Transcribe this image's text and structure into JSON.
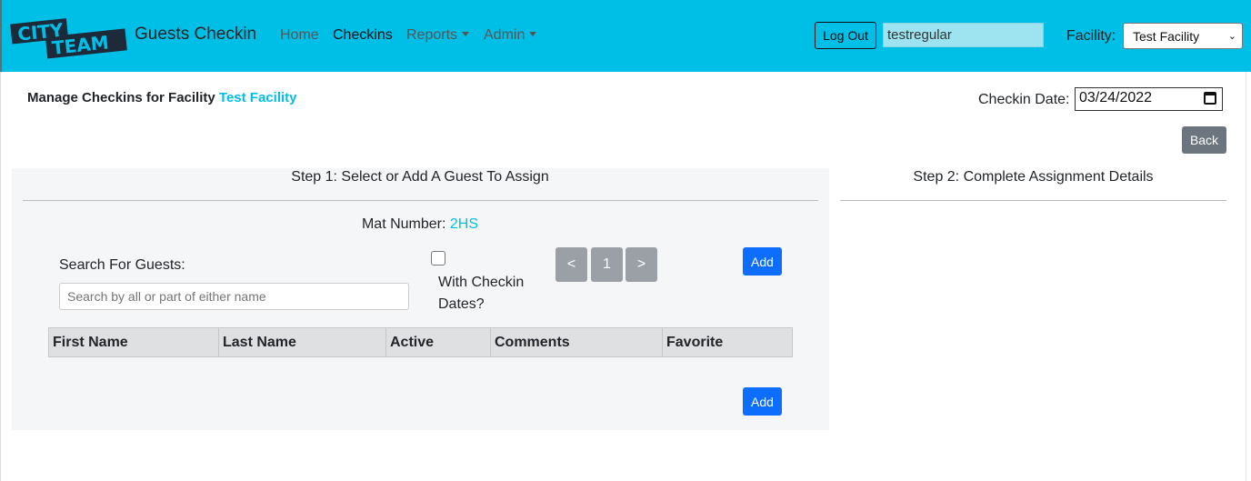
{
  "brand": {
    "logo_text_1": "CITY",
    "logo_text_2": "TEAM",
    "title": "Guests Checkin"
  },
  "nav": {
    "home": "Home",
    "checkins": "Checkins",
    "reports": "Reports",
    "admin": "Admin"
  },
  "header": {
    "logout_label": "Log Out",
    "username": "testregular",
    "facility_label": "Facility:",
    "facility_selected": "Test Facility"
  },
  "page": {
    "heading_prefix": "Manage Checkins for Facility",
    "facility_name": "Test Facility",
    "checkin_date_label": "Checkin Date:",
    "checkin_date": "03/24/2022",
    "back_label": "Back"
  },
  "step1": {
    "title": "Step 1: Select or Add A Guest To Assign",
    "mat_label": "Mat Number:",
    "mat_number": "2HS",
    "search_label": "Search For Guests:",
    "search_placeholder": "Search by all or part of either name",
    "with_dates_label": "With Checkin Dates?",
    "with_dates_checked": false,
    "pager": {
      "prev": "<",
      "page": "1",
      "next": ">"
    },
    "add_label": "Add",
    "add_label_bottom": "Add",
    "columns": [
      "First Name",
      "Last Name",
      "Active",
      "Comments",
      "Favorite"
    ]
  },
  "step2": {
    "title": "Step 2: Complete Assignment Details"
  },
  "colors": {
    "accent": "#00bfe7",
    "primary_button": "#0d6efd",
    "secondary_button": "#6c757d",
    "pager_button": "#9aa0a6",
    "logo_dark": "#1c2a3a"
  }
}
